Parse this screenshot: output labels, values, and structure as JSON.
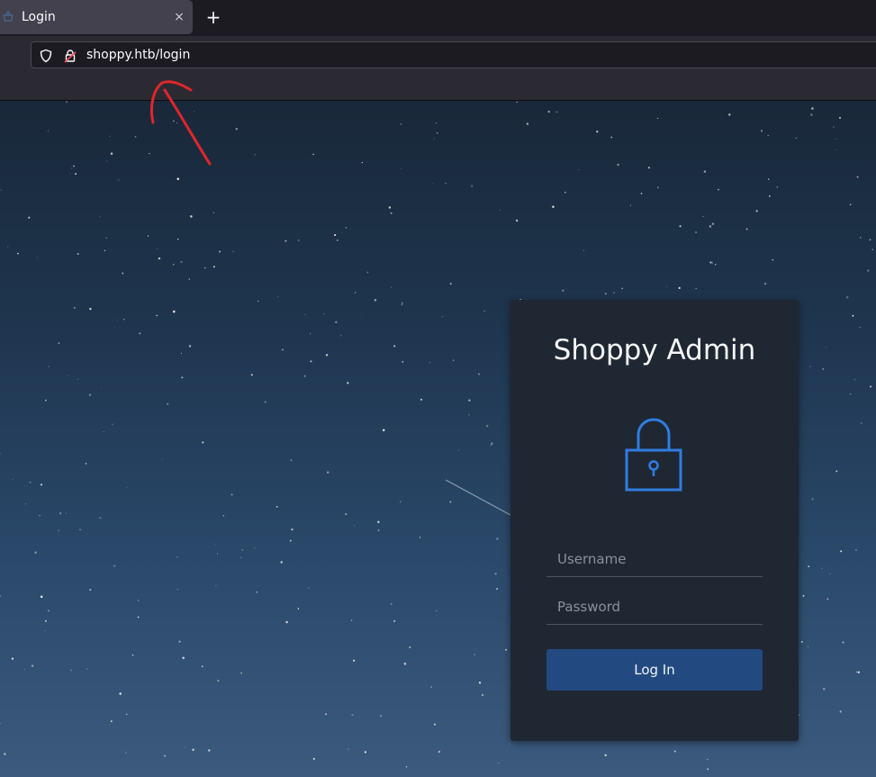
{
  "browser": {
    "tab_title": "Login",
    "tab_close_glyph": "×",
    "new_tab_glyph": "+",
    "url": "shoppy.htb/login"
  },
  "login": {
    "title": "Shoppy Admin",
    "username_placeholder": "Username",
    "password_placeholder": "Password",
    "submit_label": "Log In"
  },
  "icons": {
    "tab_favicon": "basket-icon",
    "url_shield": "shield-icon",
    "url_lock": "insecure-lock-icon",
    "card_lock": "padlock-icon"
  },
  "colors": {
    "accent": "#2f7de1",
    "button": "#234a80",
    "annotation": "#e0262a"
  }
}
